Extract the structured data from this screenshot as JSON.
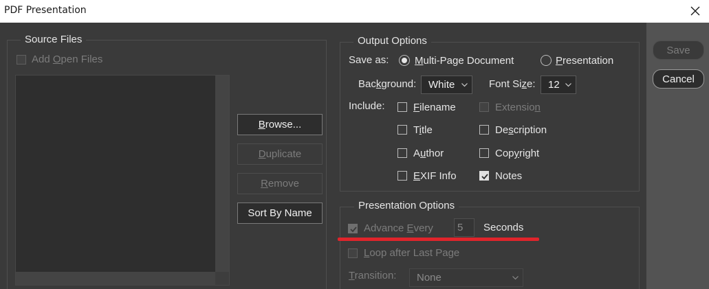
{
  "window": {
    "title": "PDF Presentation"
  },
  "source_files": {
    "legend": "Source Files",
    "add_open_files": "Add Open Files",
    "browse": "Browse...",
    "duplicate": "Duplicate",
    "remove": "Remove",
    "sort_by_name": "Sort By Name"
  },
  "output_options": {
    "legend": "Output Options",
    "save_as_label": "Save as:",
    "multi_page": "Multi-Page Document",
    "presentation": "Presentation",
    "save_as_selected": "Multi-Page Document",
    "background_label": "Background:",
    "background_value": "White",
    "font_size_label": "Font Size:",
    "font_size_value": "12",
    "include_label": "Include:",
    "filename": "Filename",
    "extension": "Extension",
    "title": "Title",
    "description": "Description",
    "author": "Author",
    "copyright": "Copyright",
    "exif_info": "EXIF Info",
    "notes": "Notes"
  },
  "checkboxes": {
    "add_open_files": false,
    "filename": false,
    "extension": false,
    "title": false,
    "description": false,
    "author": false,
    "copyright": false,
    "exif_info": false,
    "notes": true,
    "advance_every": true,
    "loop_after_last_page": false
  },
  "presentation_options": {
    "legend": "Presentation Options",
    "advance_every": "Advance Every",
    "seconds_value": "5",
    "seconds_label": "Seconds",
    "loop": "Loop after Last Page",
    "transition_label": "Transition:",
    "transition_value": "None"
  },
  "actions": {
    "save": "Save",
    "cancel": "Cancel"
  },
  "colors": {
    "panel": "#3a3a3a",
    "chrome": "#535353",
    "annotation": "#e0242b"
  }
}
